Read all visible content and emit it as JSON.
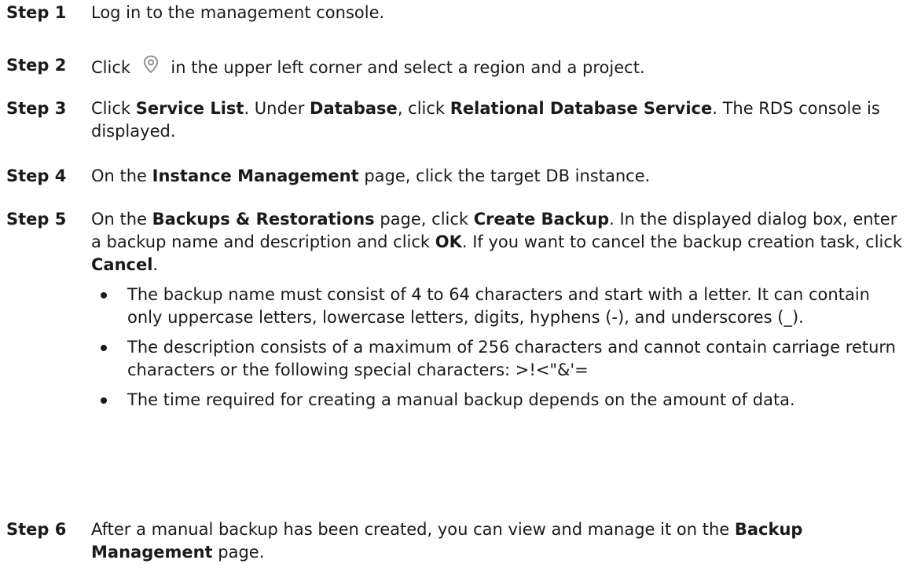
{
  "steps": [
    {
      "label": "Step 1",
      "text": "Log in to the management console."
    },
    {
      "label": "Step 2",
      "parts": [
        "Click ",
        " in the upper left corner and select a region and a project."
      ],
      "icon": "location-pin-icon"
    },
    {
      "label": "Step 3",
      "parts": [
        "Click ",
        "Service List",
        ". Under ",
        "Database",
        ", click ",
        "Relational Database Service",
        ". The RDS console is displayed."
      ]
    },
    {
      "label": "Step 4",
      "parts": [
        "On the ",
        "Instance Management",
        " page, click the target DB instance."
      ]
    },
    {
      "label": "Step 5",
      "parts": [
        "On the ",
        "Backups & Restorations",
        " page, click ",
        "Create Backup",
        ". In the displayed dialog box, enter a backup name and description and click ",
        "OK",
        ". If you want to cancel the backup creation task, click ",
        "Cancel",
        "."
      ],
      "bullets": [
        "The backup name must consist of 4 to 64 characters and start with a letter. It can contain only uppercase letters, lowercase letters, digits, hyphens (-), and underscores (_).",
        "The description consists of a maximum of 256 characters and cannot contain carriage return characters or the following special characters: >!<\"&'=",
        "The time required for creating a manual backup depends on the amount of data."
      ]
    },
    {
      "label": "Step 6",
      "parts": [
        "After a manual backup has been created, you can view and manage it on the ",
        "Backup Management",
        " page."
      ]
    }
  ],
  "colors": {
    "text": "#1a1a1a",
    "icon": "#8a8a8a"
  }
}
